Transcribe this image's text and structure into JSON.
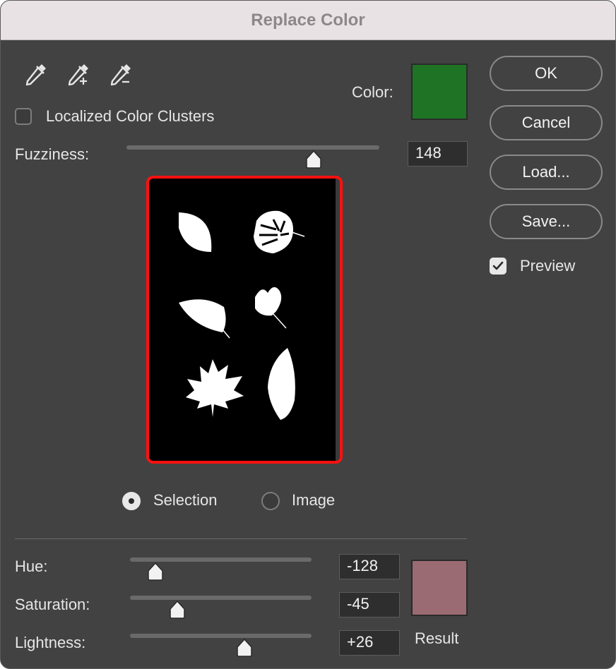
{
  "window": {
    "title": "Replace Color"
  },
  "tools": [
    "eyedropper-icon",
    "eyedropper-plus-icon",
    "eyedropper-minus-icon"
  ],
  "color": {
    "label": "Color:",
    "swatch": "#1e7424"
  },
  "localized": {
    "label": "Localized Color Clusters",
    "checked": false
  },
  "fuzziness": {
    "label": "Fuzziness:",
    "value": "148",
    "fraction": 0.74
  },
  "view": {
    "selection_label": "Selection",
    "image_label": "Image",
    "selected": "Selection"
  },
  "buttons": {
    "ok": "OK",
    "cancel": "Cancel",
    "load": "Load...",
    "save": "Save..."
  },
  "preview": {
    "label": "Preview",
    "checked": true
  },
  "hue": {
    "label": "Hue:",
    "value": "-128",
    "fraction": 0.14
  },
  "saturation": {
    "label": "Saturation:",
    "value": "-45",
    "fraction": 0.26
  },
  "lightness": {
    "label": "Lightness:",
    "value": "+26",
    "fraction": 0.63
  },
  "result": {
    "label": "Result",
    "swatch": "#9a6b72"
  },
  "colors": {
    "accent_outline": "#ff1010",
    "background": "#424242"
  }
}
